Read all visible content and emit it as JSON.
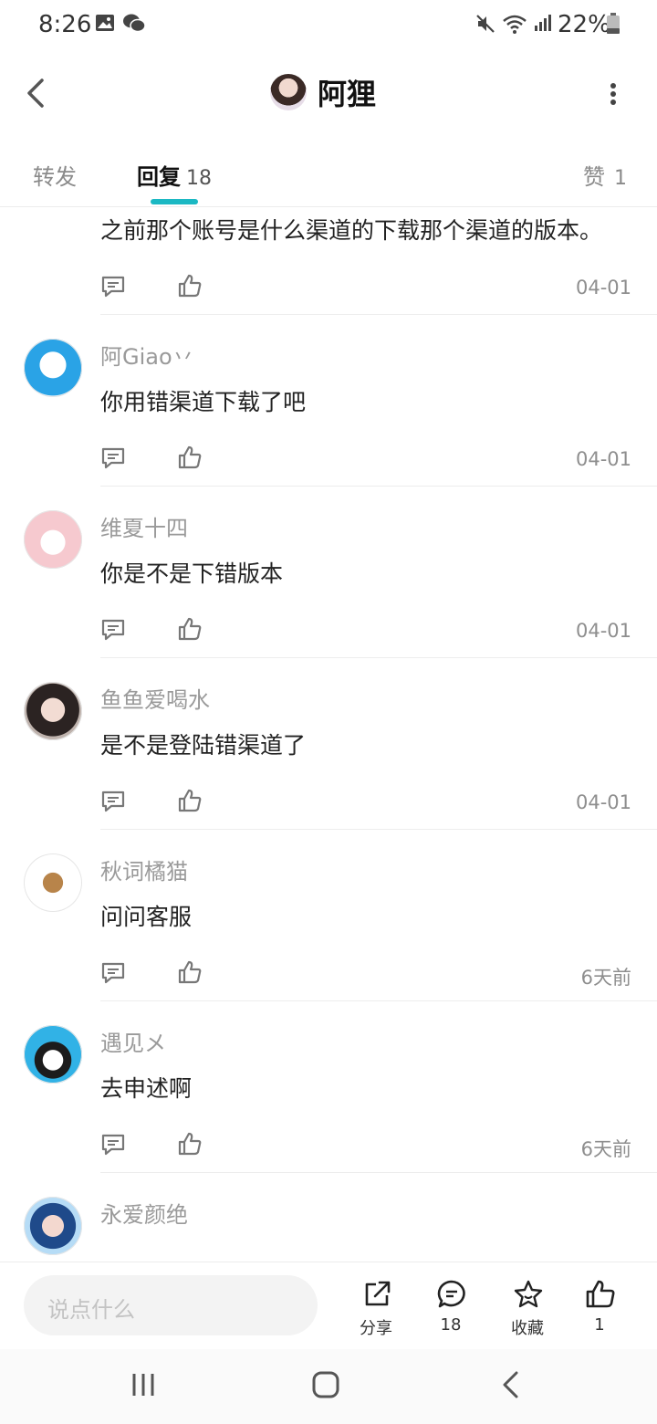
{
  "status_bar": {
    "time": "8:26",
    "battery": "22%"
  },
  "header": {
    "title": "阿狸"
  },
  "tabs": {
    "repost": "转发",
    "reply": "回复",
    "reply_count": "18",
    "like": "赞",
    "like_count": "1"
  },
  "comments": [
    {
      "name": "",
      "text": "之前那个账号是什么渠道的下载那个渠道的版本。",
      "date": "04-01"
    },
    {
      "name": "阿Giao丷",
      "text": "你用错渠道下载了吧",
      "date": "04-01"
    },
    {
      "name": "维夏十四",
      "text": "你是不是下错版本",
      "date": "04-01"
    },
    {
      "name": "鱼鱼爱喝水",
      "text": "是不是登陆错渠道了",
      "date": "04-01"
    },
    {
      "name": "秋词橘猫",
      "text": "问问客服",
      "date": "6天前"
    },
    {
      "name": "遇见メ",
      "text": "去申述啊",
      "date": "6天前"
    },
    {
      "name": "永爱颜绝",
      "text": "",
      "date": ""
    }
  ],
  "action_bar": {
    "input_placeholder": "说点什么",
    "share_label": "分享",
    "comment_count": "18",
    "favorite_label": "收藏",
    "like_count": "1"
  }
}
